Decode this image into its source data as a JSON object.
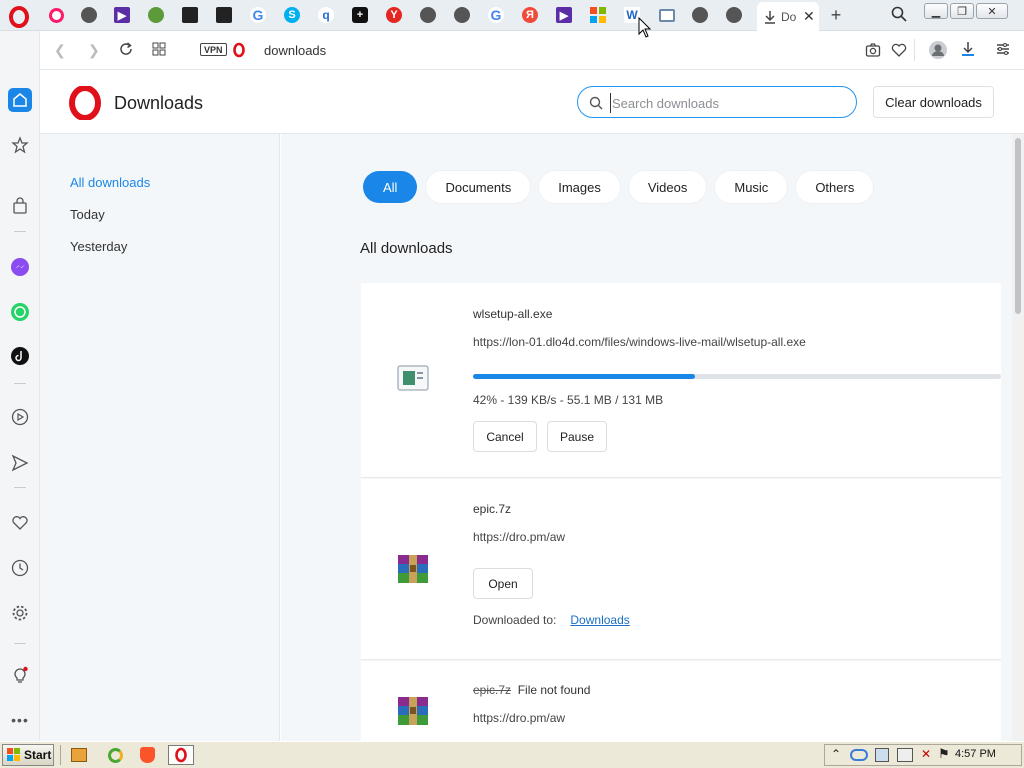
{
  "tabs": {
    "active_title": "Do",
    "items": [
      "opera-gx",
      "globe",
      "player",
      "globe2",
      "shopping",
      "shopping2",
      "google",
      "skype",
      "search",
      "add",
      "yandex",
      "globe3",
      "globe4",
      "google2",
      "yandex2",
      "player2",
      "windows",
      "wlive",
      "screen",
      "globe5",
      "globe6"
    ]
  },
  "address": {
    "vpn_label": "VPN",
    "url": "downloads"
  },
  "page": {
    "title": "Downloads",
    "search_placeholder": "Search downloads",
    "clear_label": "Clear downloads"
  },
  "sidebar": {
    "items": [
      {
        "label": "All downloads",
        "active": true
      },
      {
        "label": "Today",
        "active": false
      },
      {
        "label": "Yesterday",
        "active": false
      }
    ]
  },
  "filters": {
    "items": [
      "All",
      "Documents",
      "Images",
      "Videos",
      "Music",
      "Others"
    ],
    "active": "All"
  },
  "section_title": "All downloads",
  "downloads": [
    {
      "name": "wlsetup-all.exe",
      "url": "https://lon-01.dlo4d.com/files/windows-live-mail/wlsetup-all.exe",
      "progress": 0.42,
      "status": "42% - 139 KB/s - 55.1 MB / 131 MB",
      "cancel_label": "Cancel",
      "pause_label": "Pause"
    },
    {
      "name": "epic.7z",
      "url": "https://dro.pm/aw",
      "open_label": "Open",
      "downloaded_to_label": "Downloaded to:",
      "downloaded_to_link": "Downloads"
    },
    {
      "name": "epic.7z",
      "error": "File not found",
      "url": "https://dro.pm/aw"
    }
  ],
  "taskbar": {
    "start_label": "Start",
    "clock": "4:57 PM"
  },
  "colors": {
    "accent": "#1a87e8",
    "opera_red": "#e0111b"
  }
}
